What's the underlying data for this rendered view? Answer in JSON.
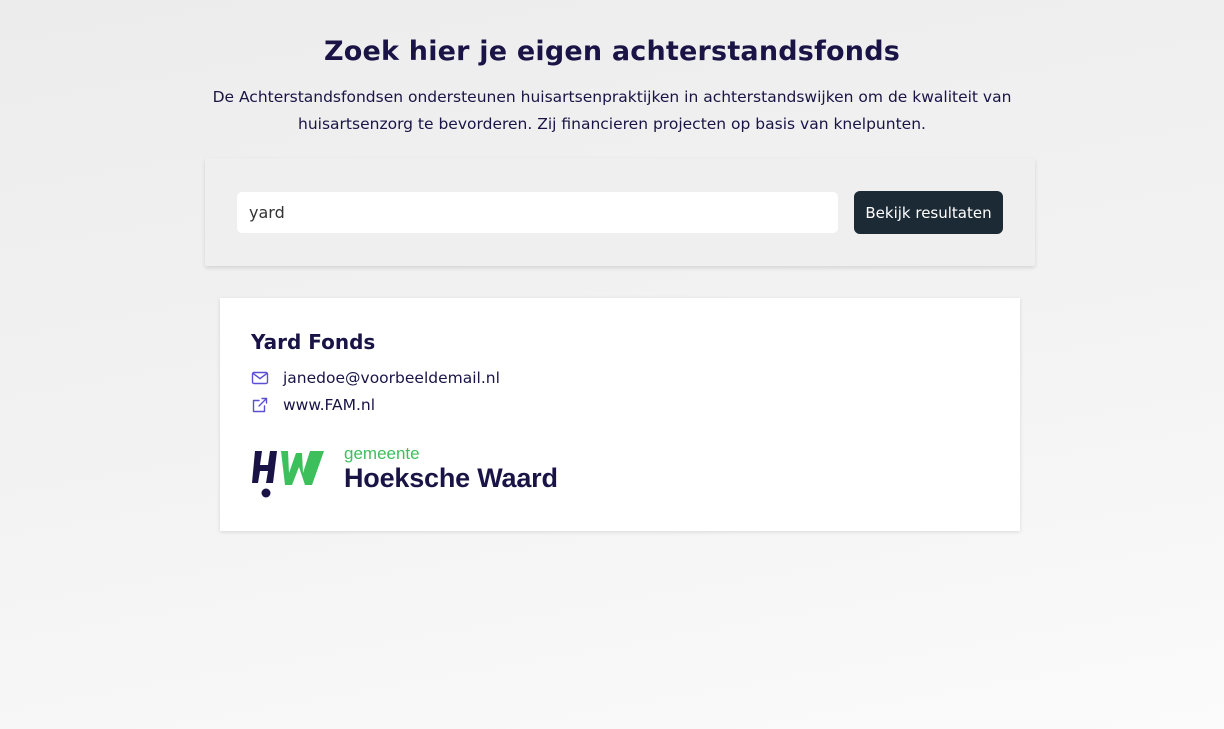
{
  "header": {
    "title": "Zoek hier je eigen achterstandsfonds",
    "description": "De Achterstandsfondsen ondersteunen huisartsenpraktijken in achterstandswijken om de kwaliteit van huisartsenzorg te bevorderen. Zij financieren projecten op basis van knelpunten."
  },
  "search": {
    "value": "yard",
    "button_label": "Bekijk resultaten"
  },
  "results": [
    {
      "title": "Yard Fonds",
      "email": "janedoe@voorbeeldemail.nl",
      "website": "www.FAM.nl",
      "logo": {
        "sub": "gemeente",
        "main": "Hoeksche Waard"
      }
    }
  ],
  "colors": {
    "primary_text": "#1a1446",
    "button_bg": "#1b2a35",
    "icon_accent": "#5b4fd6",
    "logo_green": "#3dbf5c"
  },
  "icons": {
    "email": "mail-icon",
    "website": "external-link-icon"
  }
}
